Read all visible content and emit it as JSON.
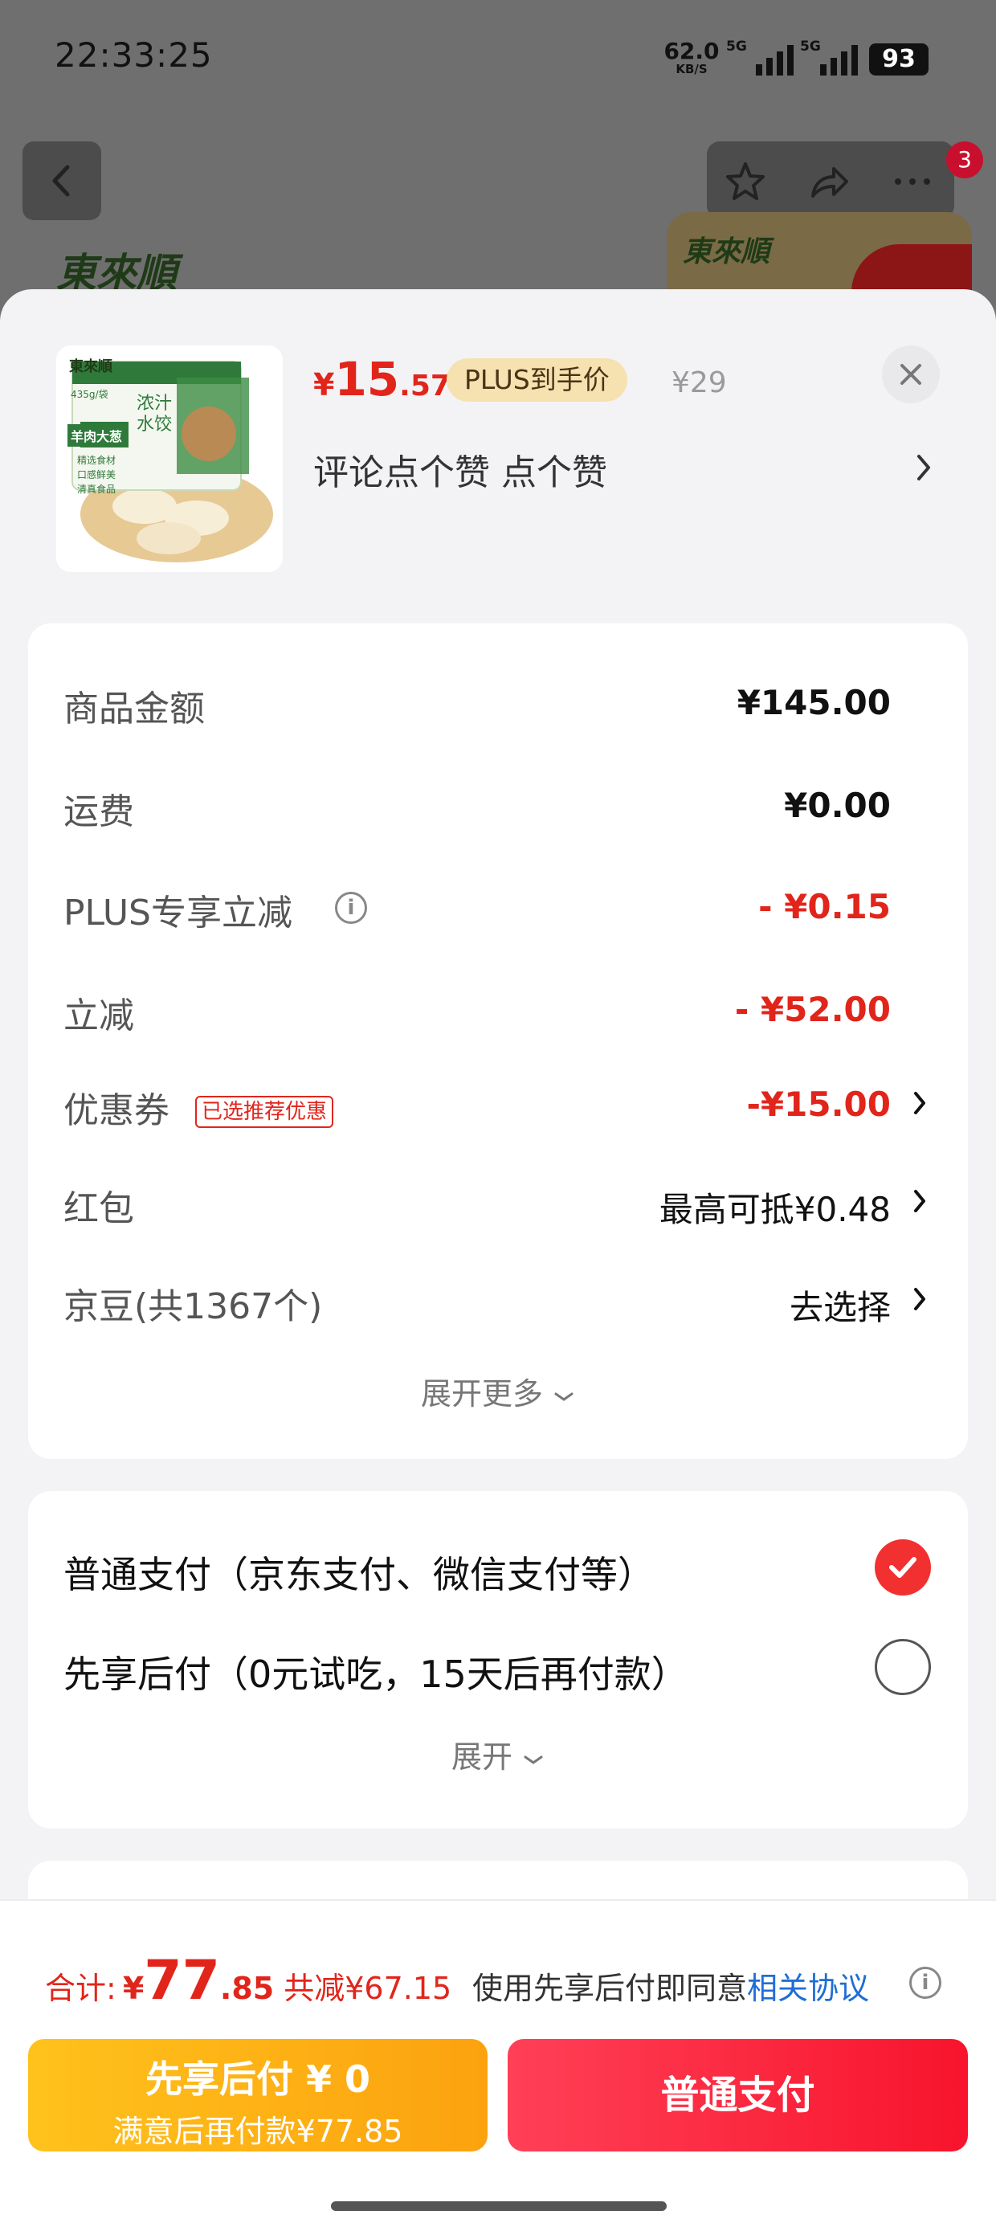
{
  "status_bar": {
    "time": "22:33:25",
    "net_speed": "62.0",
    "net_unit": "KB/S",
    "signal_1": "5G",
    "signal_2": "5G",
    "battery": "93"
  },
  "background": {
    "badge_count": "3",
    "brand_logo": "東來順"
  },
  "product": {
    "price_symbol": "¥",
    "price_int": "15",
    "price_dec": ".57",
    "plus_tag": "PLUS到手价",
    "original_price": "¥29",
    "spec": "评论点个赞  点个赞",
    "image_text": {
      "brand": "東來順",
      "weight": "435g/袋",
      "flavor": "羊肉大葱",
      "line1": "精选食材",
      "line2": "口感鲜美",
      "line3": "清真食品",
      "slogan": "浓汁水饺"
    }
  },
  "fees": {
    "rows": [
      {
        "label": "商品金额",
        "value": "¥145.00"
      },
      {
        "label": "运费",
        "value": "¥0.00"
      },
      {
        "label": "PLUS专享立减",
        "value": "- ¥0.15"
      },
      {
        "label": "立减",
        "value": "- ¥52.00"
      },
      {
        "label": "优惠券",
        "tag": "已选推荐优惠",
        "value": "-¥15.00"
      },
      {
        "label": "红包",
        "value": "最高可抵¥0.48"
      },
      {
        "label": "京豆(共1367个)",
        "value": "去选择"
      }
    ],
    "expand_label": "展开更多"
  },
  "payment": {
    "options": [
      {
        "label": "普通支付（京东支付、微信支付等）",
        "selected": true
      },
      {
        "label": "先享后付（0元试吃，15天后再付款）",
        "selected": false
      }
    ],
    "expand_label": "展开"
  },
  "footer": {
    "total_label": "合计:",
    "total_symbol": "¥",
    "total_int": "77",
    "total_dec": ".85",
    "saved": "共减¥67.15",
    "agree_text": "使用先享后付即同意",
    "agree_link": "相关协议",
    "bnpl_line1": "先享后付 ¥ 0",
    "bnpl_line2": "满意后再付款¥77.85",
    "normal_pay": "普通支付"
  },
  "colors": {
    "price_red": "#e1251b",
    "pay_red": "#f7142c",
    "bnpl_yellow": "#fca20f",
    "link_blue": "#1f6ed4"
  }
}
